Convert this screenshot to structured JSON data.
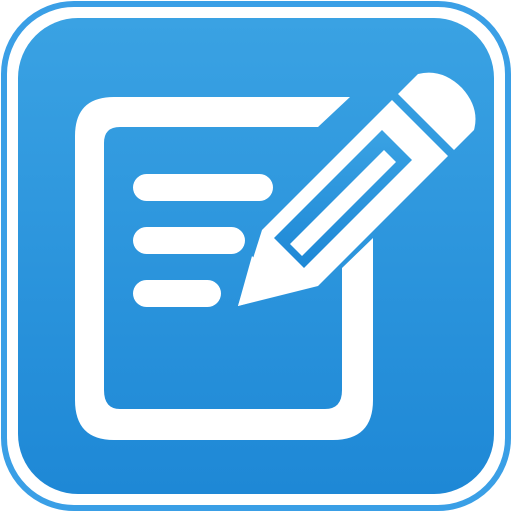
{
  "icon": {
    "name": "edit-note-icon",
    "colors": {
      "background_top": "#3aa2e3",
      "background_bottom": "#1e88d6",
      "border": "#3a9fe6",
      "glyph": "#ffffff"
    }
  }
}
